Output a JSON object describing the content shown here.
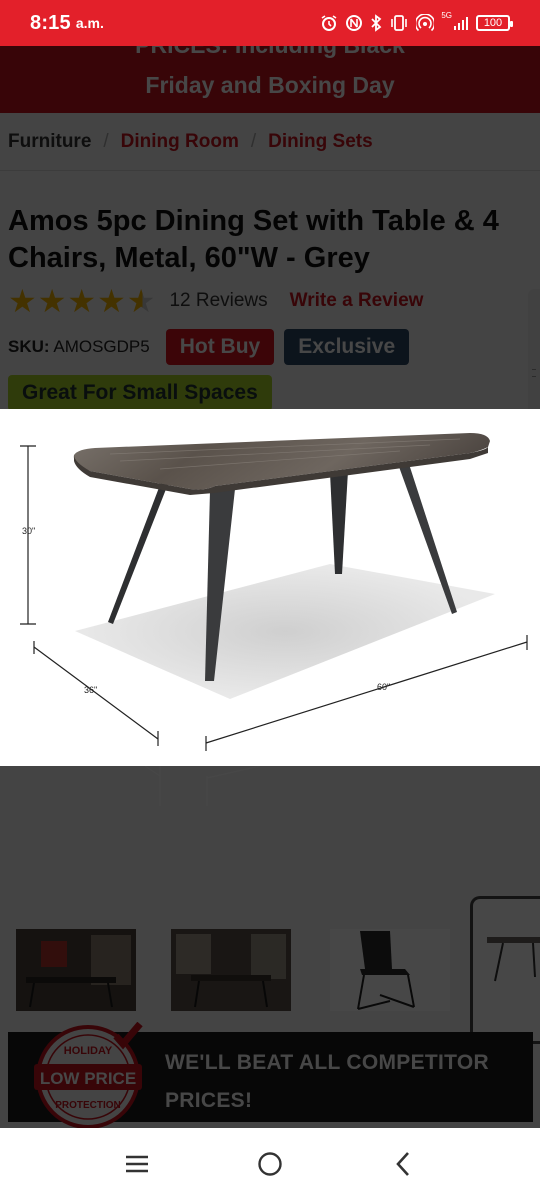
{
  "status_bar": {
    "time": "8:15",
    "ampm": "a.m.",
    "network": "5G",
    "battery": "100"
  },
  "page": {
    "promo_line1": "PRICES: Including Black",
    "promo_line2": "Friday and Boxing Day",
    "breadcrumb": [
      "Furniture",
      "Dining Room",
      "Dining Sets"
    ],
    "breadcrumb_sep": "/",
    "product_title": "Amos 5pc Dining Set with Table & 4 Chairs, Metal, 60\"W - Grey",
    "rating": 4.5,
    "reviews_count": "12 Reviews",
    "write_review": "Write a Review",
    "sku_label": "SKU:",
    "sku_value": "AMOSGDP5",
    "tags": [
      "Hot Buy",
      "Exclusive"
    ],
    "great_tag": "Great For Small Spaces",
    "beat_line1": "WE'LL BEAT ALL COMPETITOR",
    "beat_line2": "PRICES!",
    "badge": {
      "top": "HOLIDAY",
      "middle": "LOW PRICE",
      "bottom": "PROTECTION"
    }
  },
  "zoom_image": {
    "height_label": "30\"",
    "depth_label": "36\"",
    "width_label": "60\""
  },
  "colors": {
    "status_bar": "#e3202a",
    "brand_red": "#c8141e",
    "hot_buy": "#d8141f",
    "exclusive": "#2e4a66",
    "great_tag": "#a8d42a",
    "star": "#f5b301"
  },
  "nav": {
    "icons": [
      "recents-icon",
      "home-icon",
      "back-icon"
    ]
  }
}
